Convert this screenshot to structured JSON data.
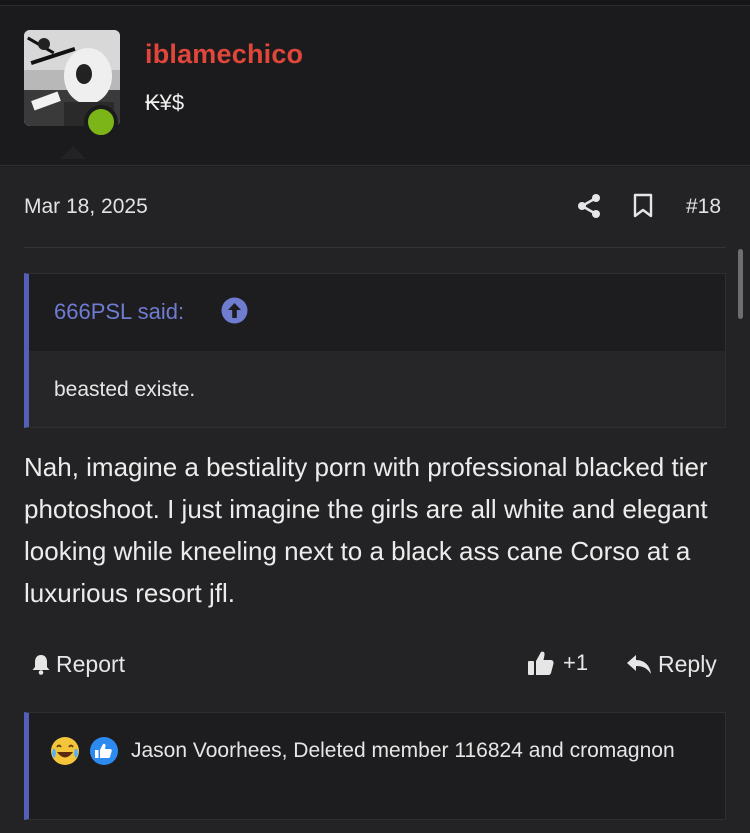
{
  "user": {
    "name": "iblamechico",
    "title": "₭¥$",
    "name_color": "#e0463a",
    "online_color": "#7cb518",
    "status": "online"
  },
  "post": {
    "date": "Mar 18, 2025",
    "number": "#18",
    "quote": {
      "author_label": "666PSL said:",
      "text": "beasted existe."
    },
    "message": "Nah, imagine a bestiality porn with professional blacked tier photoshoot. I just imagine the girls are all white and elegant looking while kneeling next to a black ass cane Corso at a luxurious resort jfl.",
    "actions": {
      "report_label": "Report",
      "like_count": "+1",
      "reply_label": "Reply"
    },
    "reactions": {
      "icons": [
        "laughing-crying-emoji-icon",
        "thumbs-up-reaction-icon"
      ],
      "text": "Jason Voorhees, Deleted member 116824 and cromagnon"
    }
  },
  "colors": {
    "accent": "#5460b8",
    "quote_author": "#6f7cd0",
    "background": "#1d1d1f",
    "post_background": "#232325"
  }
}
